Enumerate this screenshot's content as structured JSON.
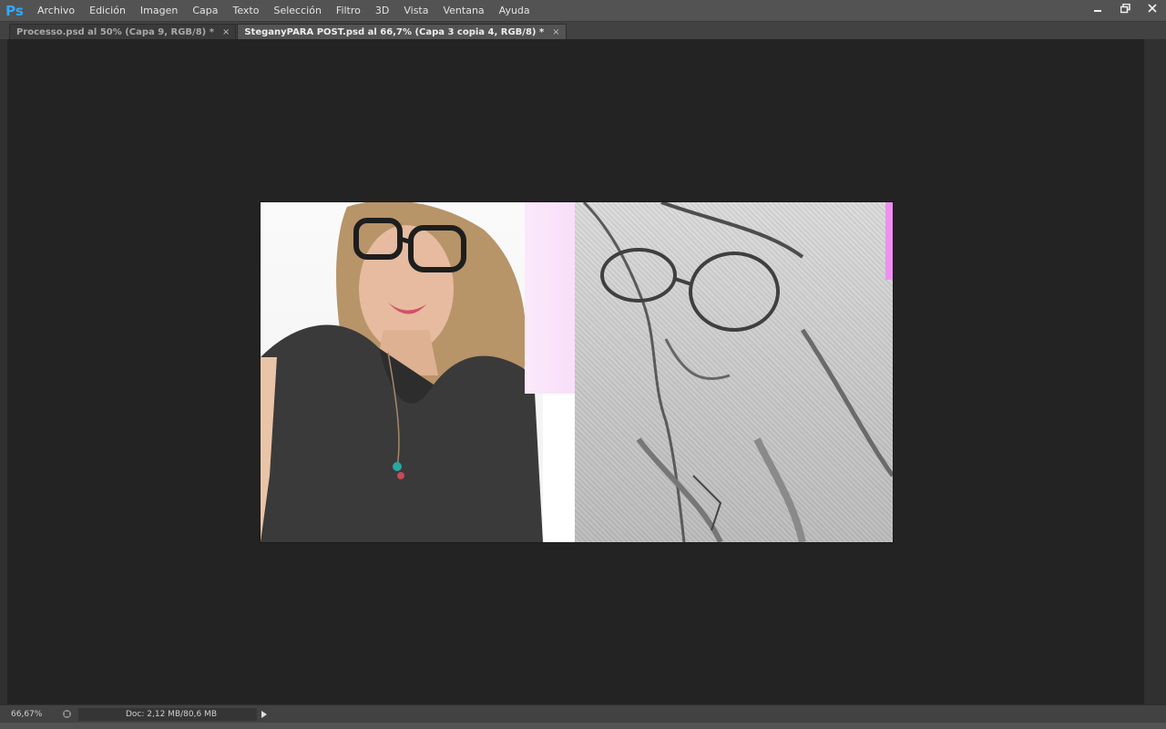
{
  "app": {
    "logo": "Ps",
    "menu": [
      "Archivo",
      "Edición",
      "Imagen",
      "Capa",
      "Texto",
      "Selección",
      "Filtro",
      "3D",
      "Vista",
      "Ventana",
      "Ayuda"
    ]
  },
  "tabs": [
    {
      "label": "Processo.psd al 50% (Capa 9, RGB/8) *",
      "close": "×",
      "active": false
    },
    {
      "label": "SteganyPARA POST.psd al 66,7% (Capa 3 copia 4, RGB/8) *",
      "close": "×",
      "active": true
    }
  ],
  "status": {
    "zoom": "66,67%",
    "doc": "Doc: 2,12 MB/80,6 MB"
  },
  "icons": {
    "minimize": "minimize-icon",
    "restore": "restore-icon",
    "close": "close-icon"
  },
  "colors": {
    "accent": "#31a8ff",
    "menubar": "#535353",
    "workspace": "#232323",
    "pink": "#ef8ff1"
  }
}
